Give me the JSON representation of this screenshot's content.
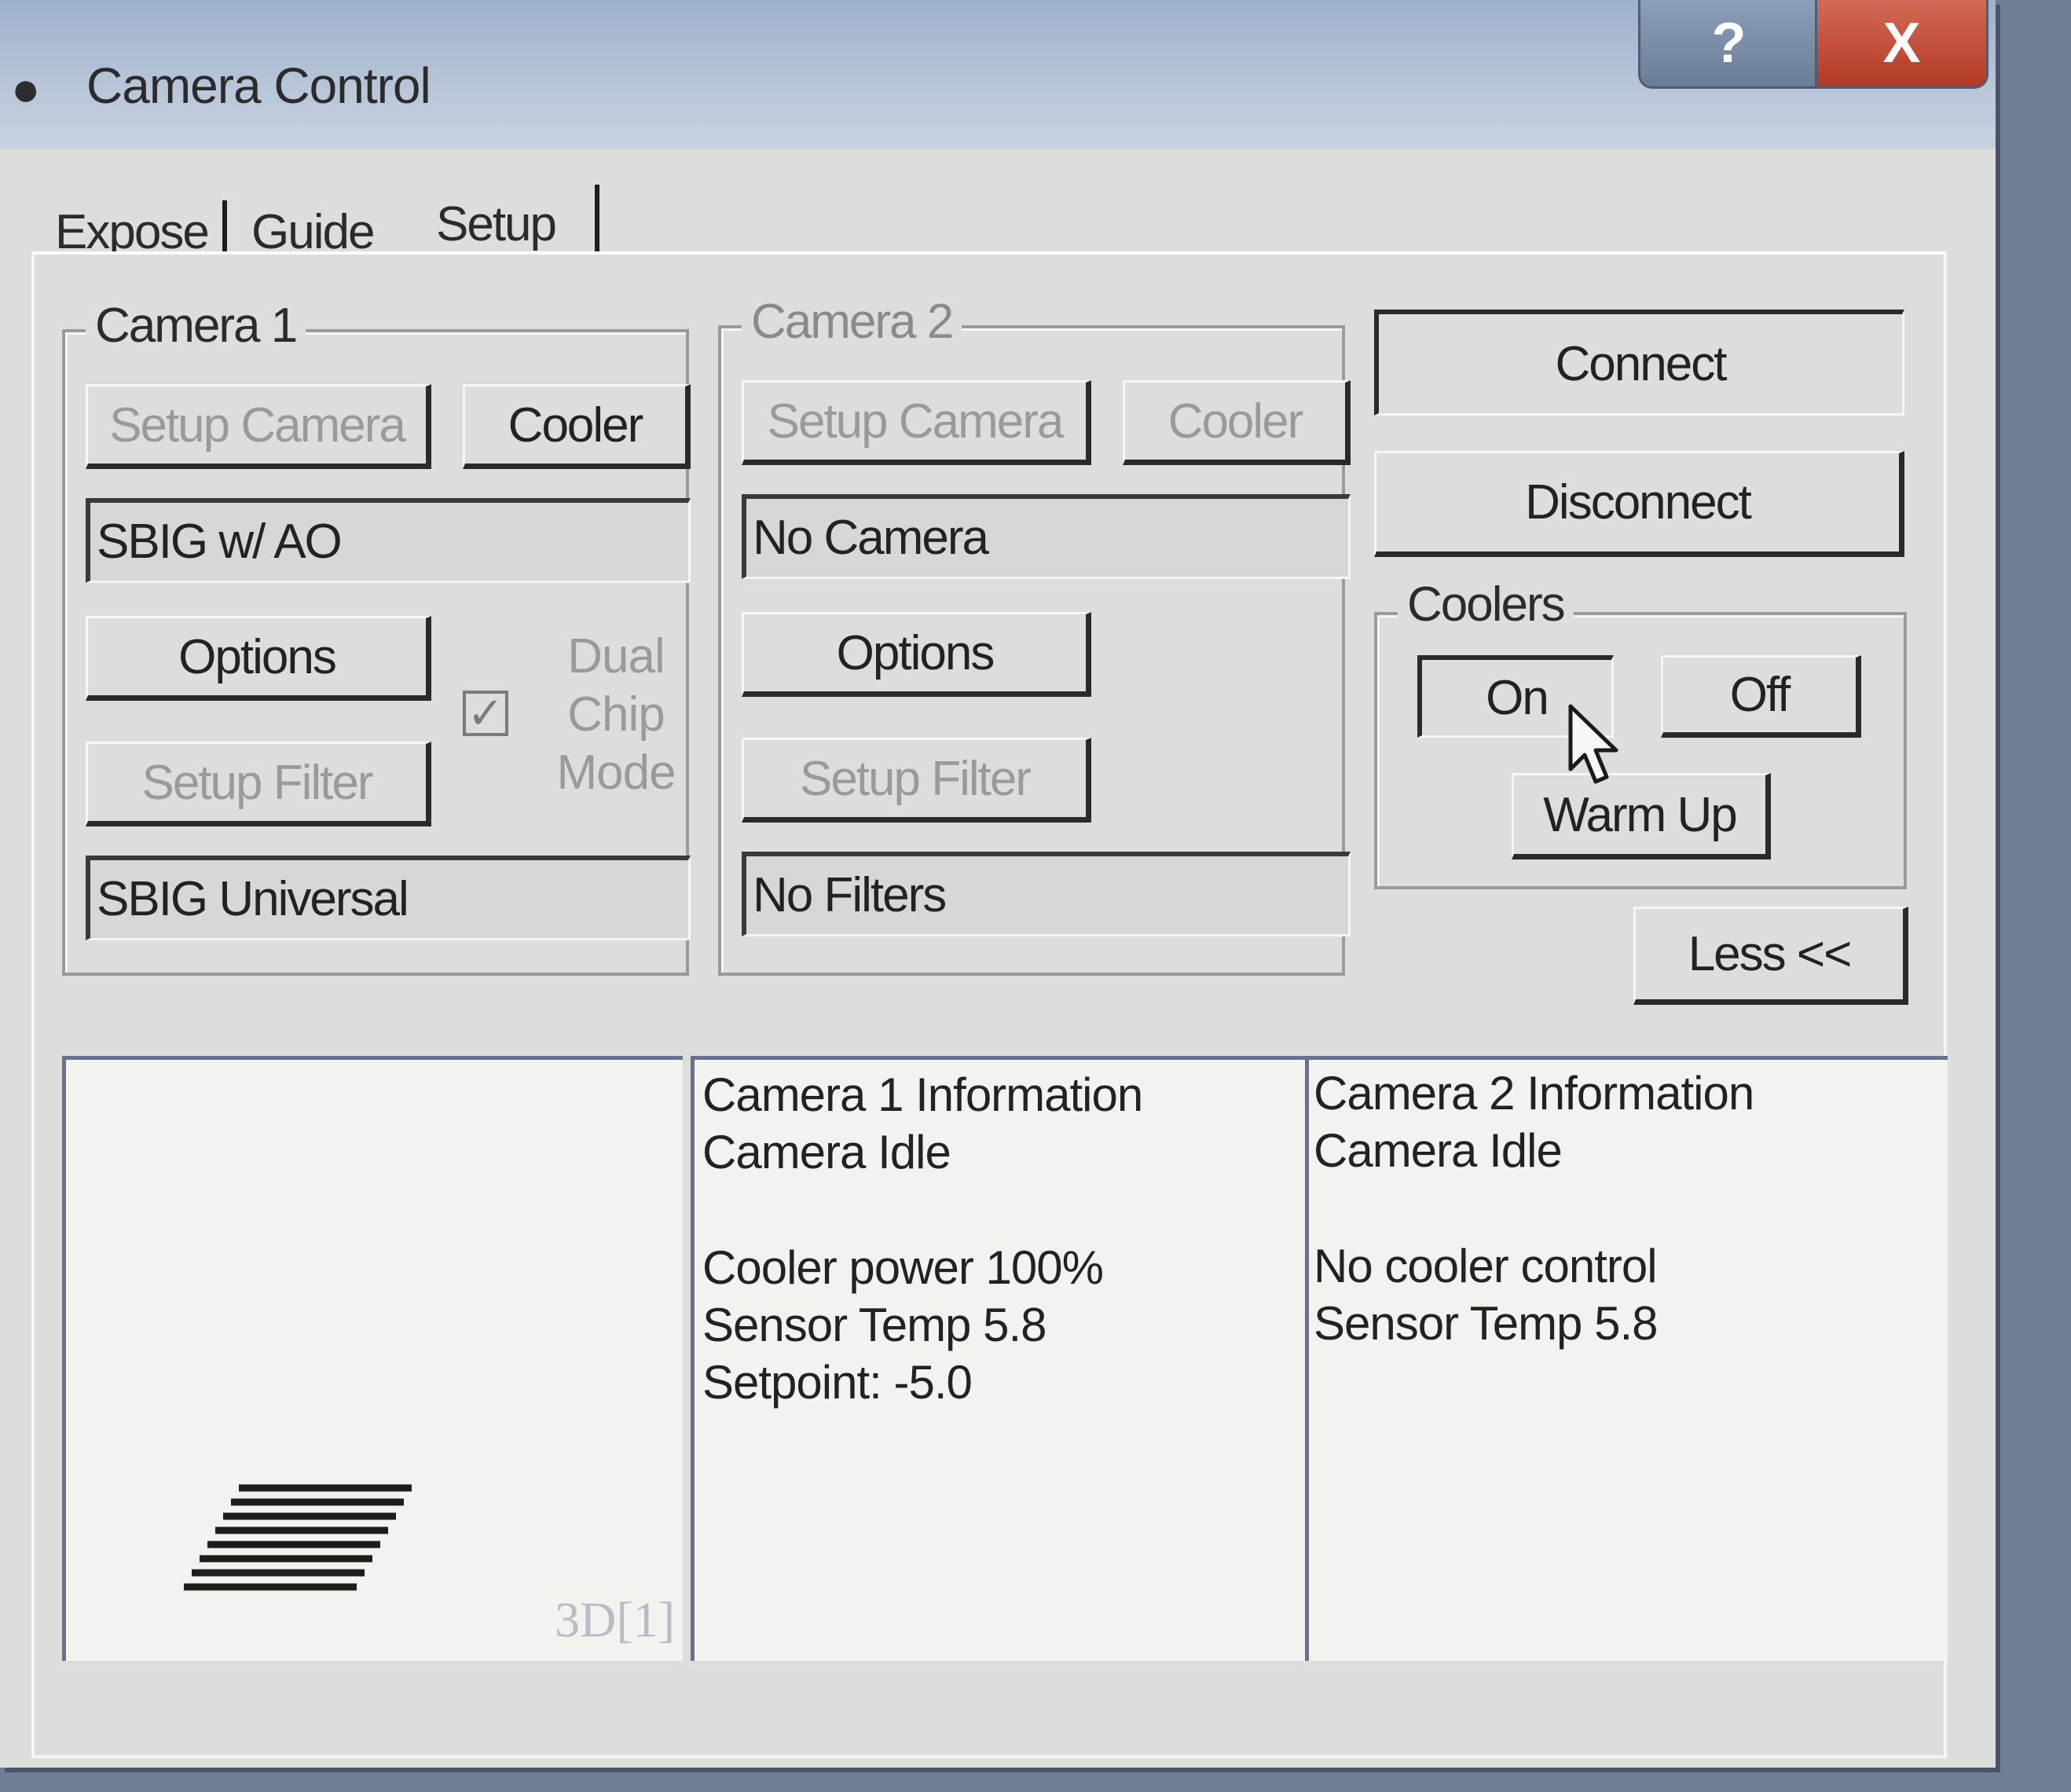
{
  "window": {
    "title": "Camera Control",
    "help_label": "?",
    "close_label": "X"
  },
  "tabs": [
    "Expose",
    "Guide",
    "Setup"
  ],
  "camera1": {
    "group_label": "Camera 1",
    "setup_camera_label": "Setup Camera",
    "cooler_label": "Cooler",
    "camera_value": "SBIG w/ AO",
    "options_label": "Options",
    "setup_filter_label": "Setup Filter",
    "filter_value": "SBIG Universal",
    "dual_chip": {
      "line1": "Dual",
      "line2": "Chip",
      "line3": "Mode",
      "checked_glyph": "✓"
    }
  },
  "camera2": {
    "group_label": "Camera 2",
    "setup_camera_label": "Setup Camera",
    "cooler_label": "Cooler",
    "camera_value": "No Camera",
    "options_label": "Options",
    "setup_filter_label": "Setup Filter",
    "filter_value": "No Filters"
  },
  "connection": {
    "connect_label": "Connect",
    "disconnect_label": "Disconnect"
  },
  "coolers": {
    "group_label": "Coolers",
    "on_label": "On",
    "off_label": "Off",
    "warm_up_label": "Warm Up"
  },
  "less_label": "Less <<",
  "preview": {
    "caption": "3D[1]"
  },
  "camera1_info": {
    "heading": "Camera 1 Information",
    "status": "Camera Idle",
    "cooler_power": "Cooler power 100%",
    "sensor_temp": "Sensor Temp 5.8",
    "setpoint": "Setpoint: -5.0"
  },
  "camera2_info": {
    "heading": "Camera 2 Information",
    "status": "Camera Idle",
    "cooler": "No cooler control",
    "sensor_temp": "Sensor Temp 5.8"
  }
}
